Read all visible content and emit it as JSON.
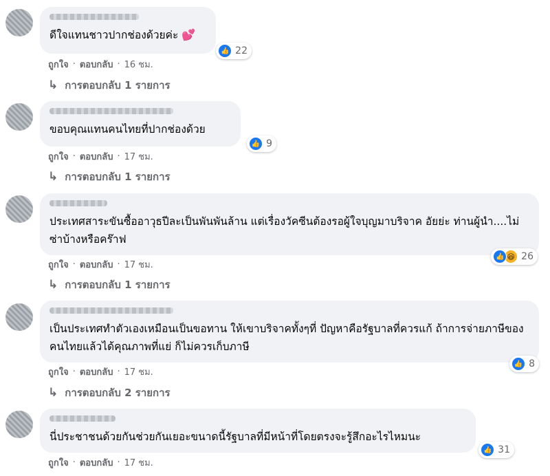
{
  "colors": {
    "bubble_bg": "#f0f2f5",
    "secondary_text": "#65676b",
    "like_blue": "#1877f2",
    "haha_yellow": "#f7b125"
  },
  "icons": {
    "like": "thumbs-up-icon",
    "haha": "laughing-face-icon",
    "heart": "two-hearts-icon",
    "reply": "reply-arrow-icon"
  },
  "comments": [
    {
      "text": "ดีใจแทนชาวปากช่องด้วยค่ะ",
      "emoji": "💕",
      "reaction_count": "22",
      "like_label": "ถูกใจ",
      "reply_label": "ตอบกลับ",
      "time": "16 ชม.",
      "replies_label": "การตอบกลับ 1 รายการ"
    },
    {
      "text": "ขอบคุณแทนคนไทยที่ปากช่องด้วย",
      "reaction_count": "9",
      "like_label": "ถูกใจ",
      "reply_label": "ตอบกลับ",
      "time": "17 ชม.",
      "replies_label": "การตอบกลับ 1 รายการ"
    },
    {
      "text": "ประเทศสาระขันซื้ออาวุธปีละเป็นพันพันล้าน แต่เรื่องวัคซีนต้องรอผู้ใจบุญมาบริจาค อัยย่ะ ท่านผู้นำ....ไม่ซ่าบ้างหรือคร๊าฟ",
      "reaction_count": "26",
      "like_label": "ถูกใจ",
      "reply_label": "ตอบกลับ",
      "time": "17 ชม.",
      "replies_label": "การตอบกลับ 1 รายการ"
    },
    {
      "text": "เป็นประเทศทำตัวเองเหมือนเป็นขอทาน ให้เขาบริจาคทั้งๆที่ ปัญหาคือรัฐบาลที่ควรแก้ ถ้าการจ่ายภาษีของคนไทยแล้วได้คุณภาพที่แย่ ก็ไม่ควรเก็บภาษี",
      "reaction_count": "8",
      "like_label": "ถูกใจ",
      "reply_label": "ตอบกลับ",
      "time": "17 ชม.",
      "replies_label": "การตอบกลับ 2 รายการ"
    },
    {
      "text": "นี่ประชาชนด้วยกันช่วยกันเยอะขนาดนี้รัฐบาลที่มีหน้าที่โดยตรงจะรู้สึกอะไรไหมนะ",
      "reaction_count": "31",
      "like_label": "ถูกใจ",
      "reply_label": "ตอบกลับ",
      "time": "17 ชม."
    }
  ],
  "separator": "·"
}
